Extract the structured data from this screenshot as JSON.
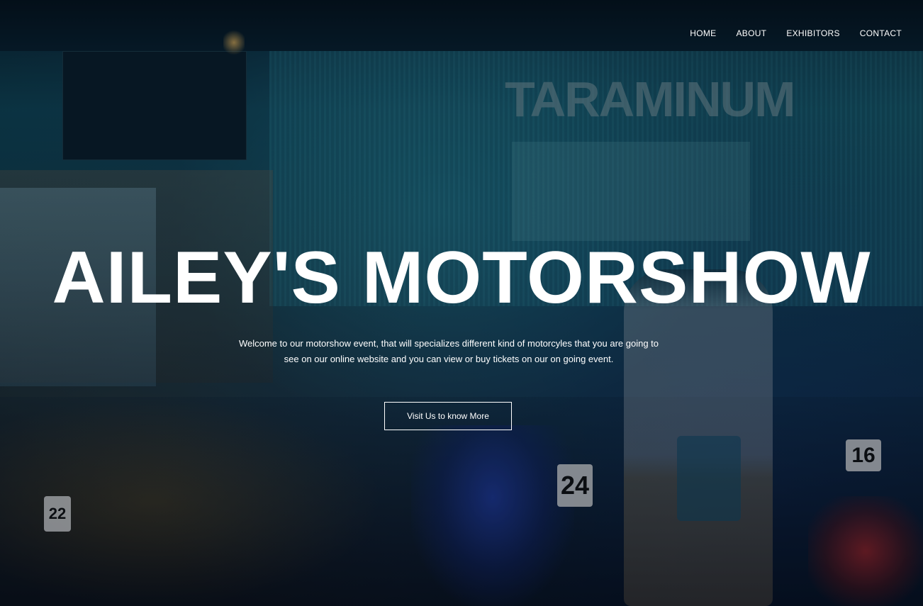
{
  "nav": {
    "items": [
      {
        "label": "HOME"
      },
      {
        "label": "ABOUT"
      },
      {
        "label": "EXHIBITORS"
      },
      {
        "label": "CONTACT"
      }
    ]
  },
  "hero": {
    "title": "AILEY'S MOTORSHOW",
    "description": "Welcome to our motorshow event, that will specializes different kind of motorcyles that you are going to see on our online website and you can view or buy tickets on our on going event.",
    "cta_label": "Visit Us to know More"
  },
  "background": {
    "wall_sign": "TARAMINUM",
    "plates": [
      "24",
      "16",
      "22"
    ]
  },
  "colors": {
    "text": "#ffffff",
    "overlay_tint": "#0a1d2a"
  }
}
